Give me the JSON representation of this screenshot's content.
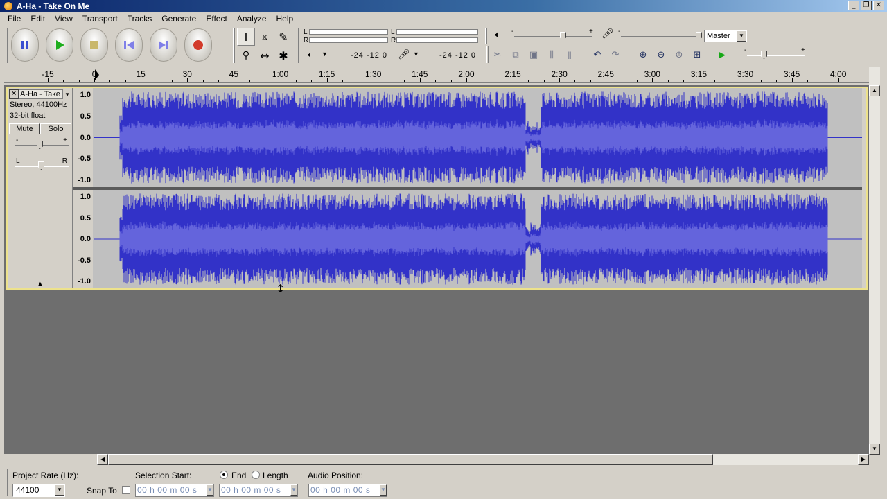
{
  "window": {
    "title": "A-Ha - Take On Me"
  },
  "menu": [
    "File",
    "Edit",
    "View",
    "Transport",
    "Tracks",
    "Generate",
    "Effect",
    "Analyze",
    "Help"
  ],
  "meters": {
    "left_label": "L",
    "right_label": "R",
    "scale_play": "-24  -12  0",
    "scale_rec": "-24  -12  0"
  },
  "mixer": {
    "output_device": "Master"
  },
  "ruler": {
    "labels": [
      "-15",
      "0",
      "15",
      "30",
      "45",
      "1:00",
      "1:15",
      "1:30",
      "1:45",
      "2:00",
      "2:15",
      "2:30",
      "2:45",
      "3:00",
      "3:15",
      "3:30",
      "3:45",
      "4:00"
    ]
  },
  "track": {
    "name": "A-Ha - Take",
    "format": "Stereo, 44100Hz",
    "bit_depth": "32-bit float",
    "mute_label": "Mute",
    "solo_label": "Solo",
    "gain_minus": "-",
    "gain_plus": "+",
    "pan_left": "L",
    "pan_right": "R",
    "vruler_labels": [
      "1.0",
      "0.5",
      "0.0",
      "-0.5",
      "-1.0"
    ]
  },
  "selection_bar": {
    "project_rate_label": "Project Rate (Hz):",
    "project_rate_value": "44100",
    "snap_to_label": "Snap To",
    "selection_start_label": "Selection Start:",
    "end_label": "End",
    "length_label": "Length",
    "audio_position_label": "Audio Position:",
    "selection_start": "00 h 00 m 00 s",
    "selection_end": "00 h 00 m 00 s",
    "audio_position": "00 h 00 m 00 s"
  },
  "colors": {
    "waveform": "#3232c8",
    "waveform_rms": "#6464dc",
    "track_bg": "#c0c0c0",
    "track_border": "#ede28c",
    "workspace": "#6e6e6e"
  }
}
